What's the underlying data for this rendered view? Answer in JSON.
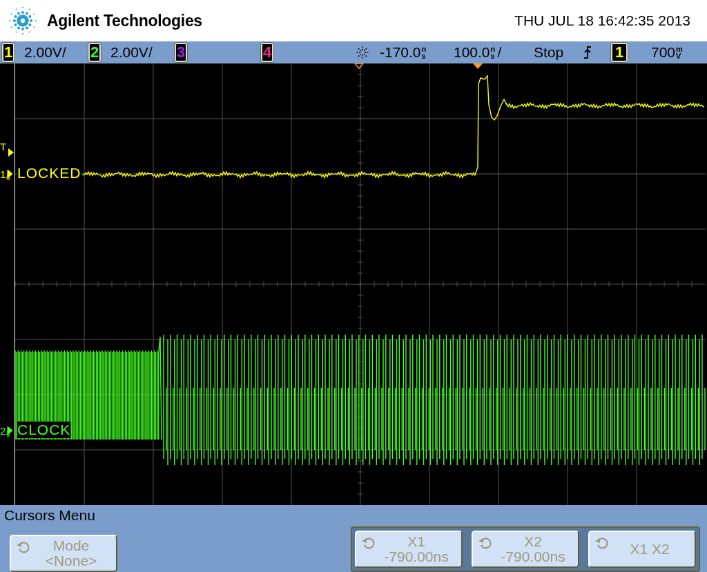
{
  "header": {
    "brand": "Agilent Technologies",
    "datetime": "THU JUL 18 16:42:35 2013"
  },
  "status_bar": {
    "channels": [
      {
        "number": "1",
        "scale": "2.00V/"
      },
      {
        "number": "2",
        "scale": "2.00V/"
      },
      {
        "number": "3"
      },
      {
        "number": "4"
      }
    ],
    "delay": {
      "value": "-170.0",
      "unit": "ns"
    },
    "timebase": {
      "value": "100.0",
      "unit": "ns",
      "suffix": "/"
    },
    "run_state": "Stop",
    "trigger": {
      "source": "1",
      "level": "700",
      "unit": "mV"
    }
  },
  "display": {
    "trigger_marker": "T",
    "traces": [
      {
        "number": "1",
        "label": "LOCKED",
        "color": "#ffff00",
        "kind": "step"
      },
      {
        "number": "2",
        "label": "CLOCK",
        "color": "#44ff22",
        "kind": "clock"
      }
    ]
  },
  "menu": {
    "title": "Cursors Menu",
    "mode_softkey": {
      "label": "Mode",
      "value": "<None>"
    },
    "cursor_softkeys": [
      {
        "label": "X1",
        "value": "-790.00ns"
      },
      {
        "label": "X2",
        "value": "-790.00ns"
      },
      {
        "label": "X1 X2"
      }
    ]
  }
}
